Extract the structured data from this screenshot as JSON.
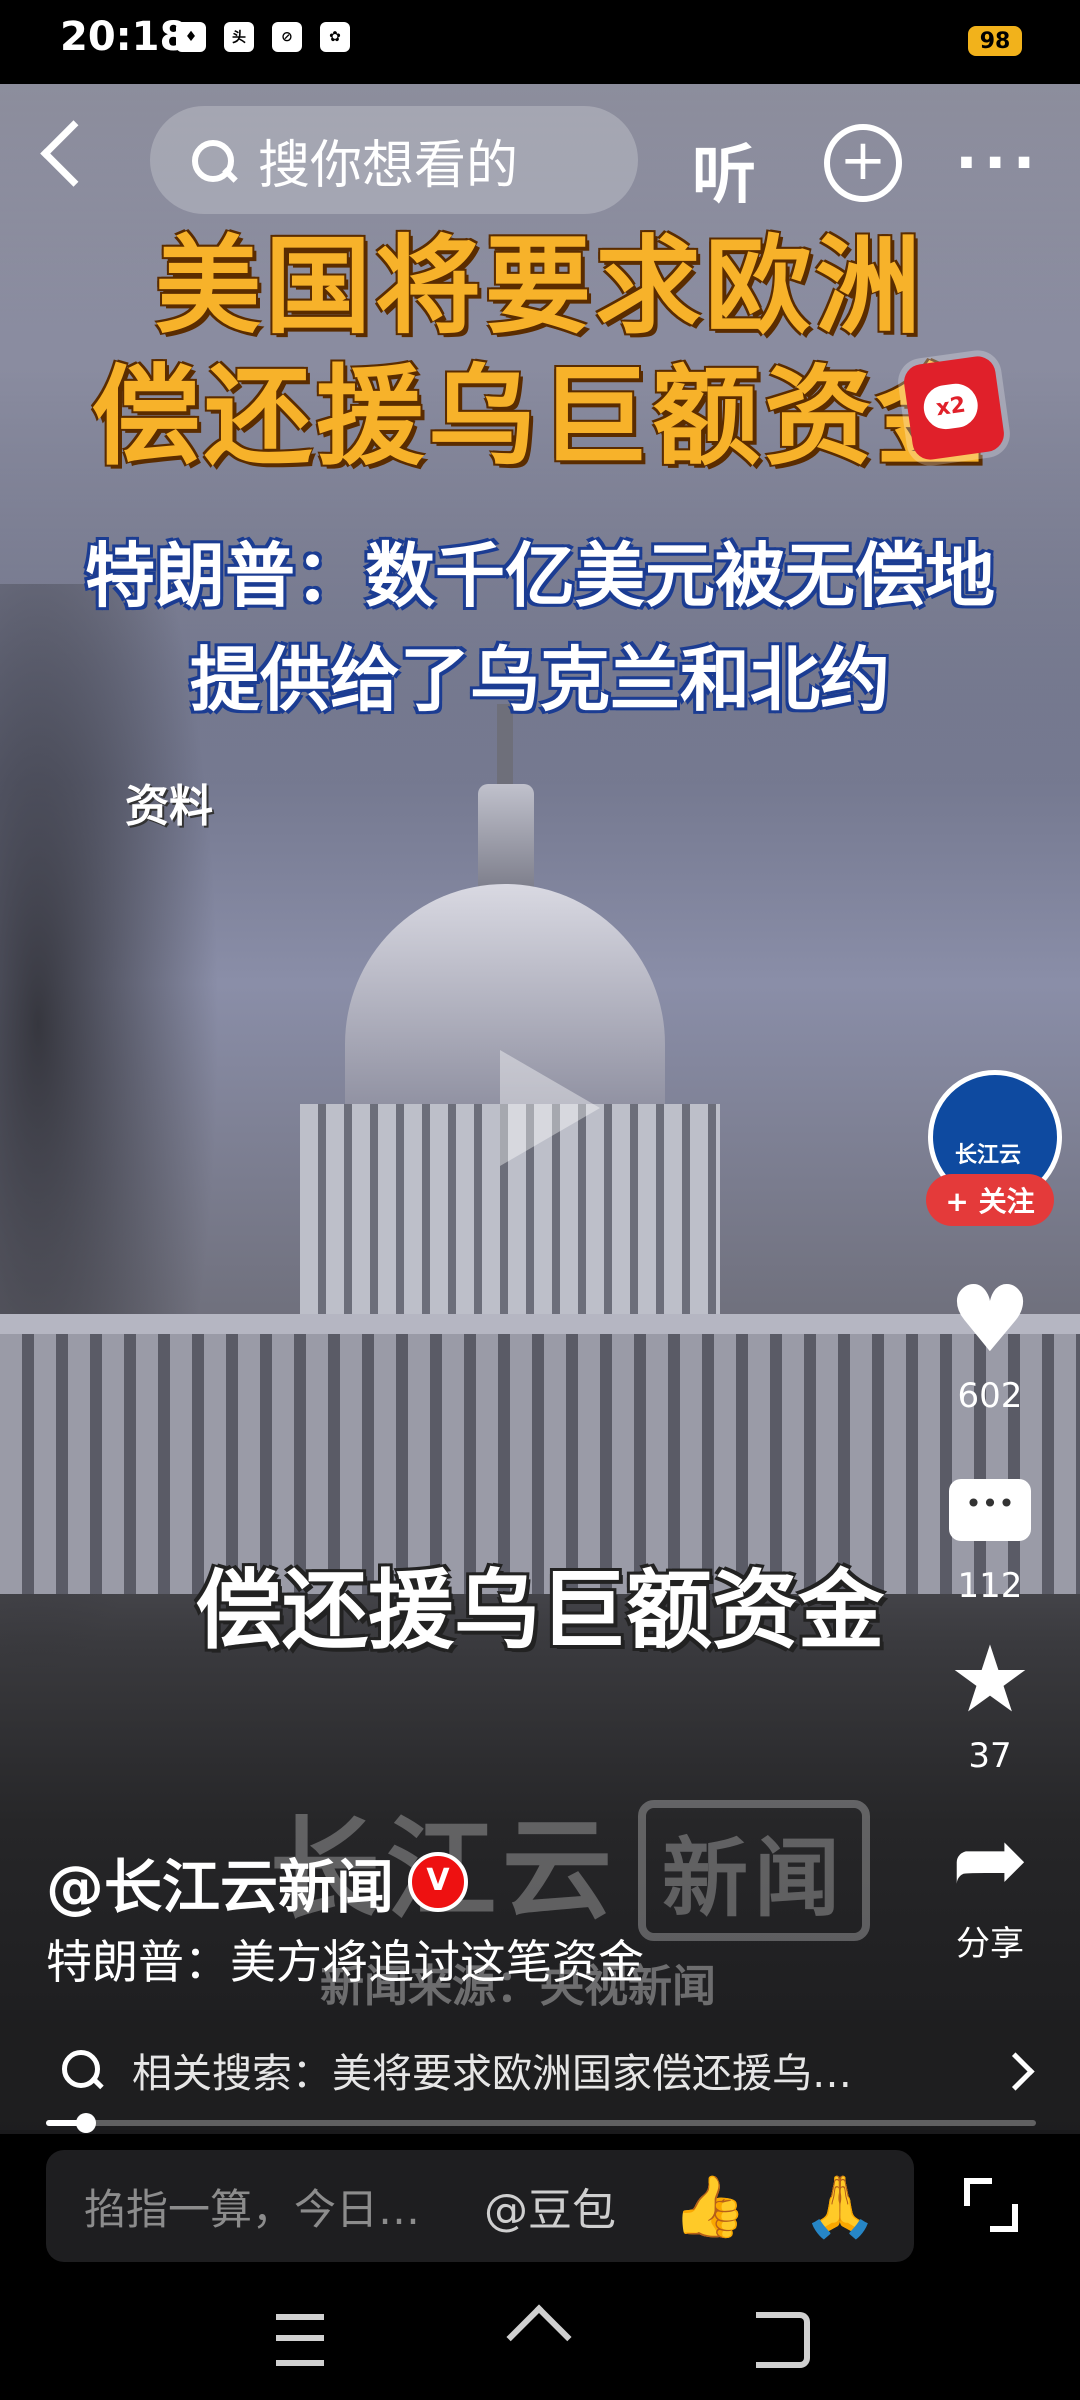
{
  "status_bar": {
    "time": "20:18",
    "battery": "98",
    "notif_icons": [
      "app-icon-1",
      "toutiao-icon",
      "app-icon-3",
      "baidu-icon"
    ]
  },
  "top_bar": {
    "search_placeholder": "搜你想看的",
    "listen_label": "听",
    "plus_label": "+",
    "more_label": "···",
    "redpack_label": "x2"
  },
  "video": {
    "title_line1": "美国将要求欧洲",
    "title_line2": "偿还援乌巨额资金",
    "subtitle_line1": "特朗普：数千亿美元被无偿地",
    "subtitle_line2": "提供给了乌克兰和北约",
    "source_tag": "资料",
    "caption": "偿还援乌巨额资金",
    "watermark_main": "长江云",
    "watermark_box": "新闻",
    "news_source": "新闻来源：央视新闻",
    "progress": 0.04
  },
  "rail": {
    "avatar_text": "长江云",
    "follow_label": "+ 关注",
    "likes": "602",
    "comments": "112",
    "favorites": "37",
    "share_label": "分享"
  },
  "post": {
    "author": "@长江云新闻",
    "verified_badge": "V",
    "description": "特朗普：美方将追讨这笔资金"
  },
  "related": {
    "text": "相关搜索：美将要求欧洲国家偿还援乌…"
  },
  "comment_bar": {
    "placeholder": "掐指一算，今日…",
    "mention": "@豆包",
    "emoji1": "👍",
    "emoji2": "🙏"
  },
  "colors": {
    "title": "#f7b22a",
    "accent_red": "#e43a3a",
    "subtitle_outline": "#1b3c92"
  }
}
